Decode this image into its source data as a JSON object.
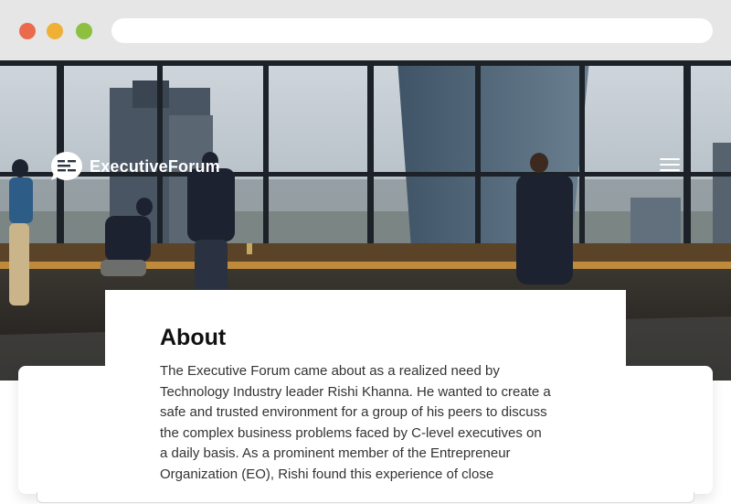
{
  "browser": {
    "window_controls": [
      "close",
      "minimize",
      "maximize"
    ],
    "address_bar_value": ""
  },
  "site": {
    "brand_name": "ExecutiveForum",
    "logo_icon": "chat-bubble-lines-icon",
    "menu_icon": "hamburger-menu-icon"
  },
  "hero": {
    "image_description_icon": "office-skyline-photo"
  },
  "about": {
    "title": "About",
    "lines": [
      "The Executive Forum came about as a realized need by",
      "Technology Industry leader Rishi Khanna. He wanted to create a",
      "safe and trusted environment for a group of his peers to discuss",
      "the complex business problems faced by C-level executives on",
      "a daily basis. As a prominent member of the Entrepreneur",
      "Organization (EO), Rishi found this experience of close"
    ]
  },
  "colors": {
    "chrome": "#e6e6e6",
    "dot_red": "#ec6a4c",
    "dot_yellow": "#efb036",
    "dot_green": "#8dc03f",
    "heading": "#111111",
    "body_text": "#333333"
  }
}
